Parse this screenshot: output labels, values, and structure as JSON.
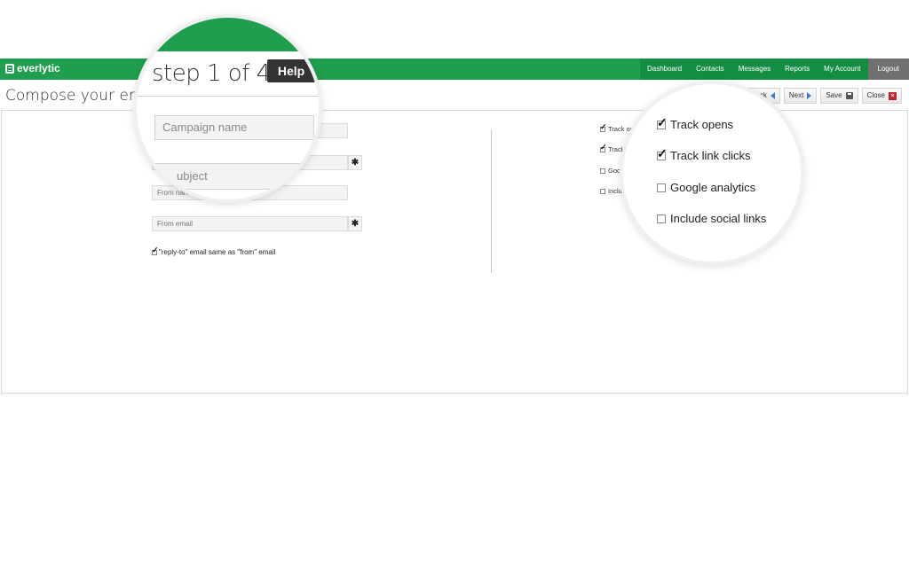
{
  "brand": {
    "name": "everlytic",
    "accent": "#1f9e4f"
  },
  "nav": {
    "items": [
      "Dashboard",
      "Contacts",
      "Messages",
      "Reports",
      "My Account"
    ],
    "logout": "Logout"
  },
  "page": {
    "title": "Compose your email"
  },
  "toolbar": {
    "back": "Back",
    "next": "Next",
    "save": "Save",
    "close": "Close"
  },
  "form": {
    "campaign_name_placeholder": "Campaign name",
    "subject_placeholder": "Subject",
    "from_name_placeholder": "From name",
    "from_email_placeholder": "From email",
    "reply_to_label": "\"reply-to\" email same as \"from\" email",
    "required_mark": "✱"
  },
  "options": {
    "track_opens": "Track opens",
    "track_link_clicks": "Track link clicks",
    "google_analytics": "Google analytics",
    "include_social_links": "Include social links",
    "track_opens_short": "Track op",
    "track_link_clicks_short": "Track",
    "google_analytics_short": "Goog",
    "include_social_links_short": "Inclu"
  },
  "wizard": {
    "step": "step 1 of 4",
    "help": "Help",
    "subject_partial": "ubject"
  }
}
